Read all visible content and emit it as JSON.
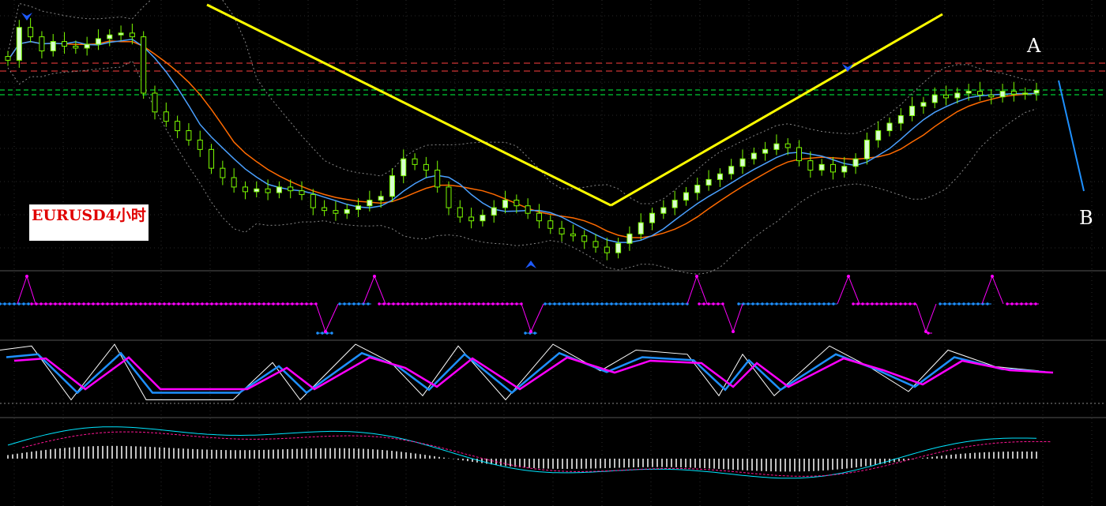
{
  "chart_data": [
    {
      "type": "candlestick",
      "symbol_label": "EURUSD4小时",
      "annotations": [
        "A",
        "B"
      ],
      "colors": {
        "background": "#000000",
        "candle": "#7cfc00",
        "trendline": "#ffff00",
        "resistance": "#ff4040",
        "support": "#00ff40",
        "ma_fast": "#4aa0ff",
        "ma_slow": "#ff6a00",
        "projection": "#1e90ff",
        "arrow": "#1e5aff"
      },
      "trend_pattern": "V",
      "close_series": [
        1.1385,
        1.142,
        1.141,
        1.1395,
        1.1405,
        1.14,
        1.1398,
        1.1402,
        1.1408,
        1.1412,
        1.1414,
        1.141,
        1.135,
        1.133,
        1.132,
        1.131,
        1.13,
        1.129,
        1.127,
        1.126,
        1.125,
        1.1245,
        1.1248,
        1.1244,
        1.125,
        1.1246,
        1.1242,
        1.1228,
        1.1225,
        1.1222,
        1.1226,
        1.123,
        1.1236,
        1.124,
        1.1262,
        1.128,
        1.1274,
        1.1268,
        1.125,
        1.1228,
        1.1218,
        1.1214,
        1.122,
        1.1228,
        1.1236,
        1.123,
        1.1222,
        1.1214,
        1.1206,
        1.12,
        1.1198,
        1.1192,
        1.1186,
        1.118,
        1.119,
        1.12,
        1.1212,
        1.1222,
        1.1228,
        1.1236,
        1.1244,
        1.1252,
        1.1258,
        1.1264,
        1.1272,
        1.128,
        1.1286,
        1.129,
        1.1296,
        1.1292,
        1.1278,
        1.1268,
        1.1274,
        1.1266,
        1.1272,
        1.128,
        1.13,
        1.131,
        1.1318,
        1.1326,
        1.1336,
        1.134,
        1.1348,
        1.1345,
        1.135,
        1.1352,
        1.1348,
        1.1346,
        1.1352,
        1.1349,
        1.135,
        1.1353
      ]
    },
    {
      "type": "line",
      "indicator": "step-oscillator",
      "colors": {
        "up": "#1e90ff",
        "down": "#ff00ff"
      },
      "levels": [
        0,
        1,
        2,
        -1
      ]
    },
    {
      "type": "line",
      "indicator": "stochastic",
      "colors": {
        "main": "#ffffff",
        "signal_fast": "#1e90ff",
        "signal_slow": "#ff00ff"
      }
    },
    {
      "type": "bar",
      "indicator": "macd",
      "colors": {
        "histogram": "#ffffff",
        "main": "#00e5ff",
        "signal": "#ff1493"
      }
    }
  ]
}
